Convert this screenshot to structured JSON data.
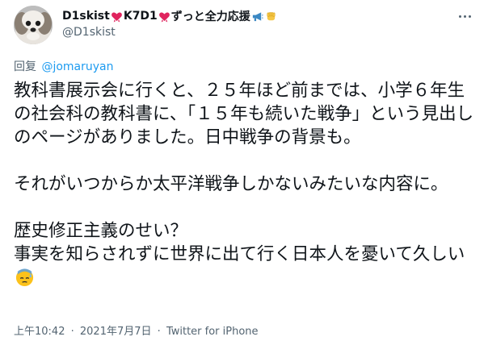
{
  "author": {
    "display_name_parts": [
      "D1skist ",
      "K7D1",
      "ずっと全力応援"
    ],
    "handle": "@D1skist",
    "name_icons": [
      "heart-ribbon-icon",
      "heart-ribbon-icon",
      "megaphone-icon",
      "raised-fist-icon"
    ]
  },
  "reply": {
    "prefix": "回复",
    "to_handle": "@jomaruyan"
  },
  "tweet": {
    "paragraphs": [
      "教科書展示会に行くと、２５年ほど前までは、小学６年生の社会科の教科書に、「１５年も続いた戦争」という見出しのページがありました。日中戦争の背景も。",
      "それがいつからか太平洋戦争しかないみたいな内容に。",
      "歴史修正主義のせい？\n事実を知らされずに世界に出て行く日本人を憂いて久しい"
    ],
    "trailing_emoji": "sweat-face-icon"
  },
  "meta": {
    "time": "上午10:42",
    "separator": "·",
    "date": "2021年7月7日",
    "source": "Twitter for iPhone"
  },
  "colors": {
    "text": "#0f1419",
    "secondary": "#536471",
    "link": "#1d9bf0",
    "heart": "#e0245e"
  }
}
